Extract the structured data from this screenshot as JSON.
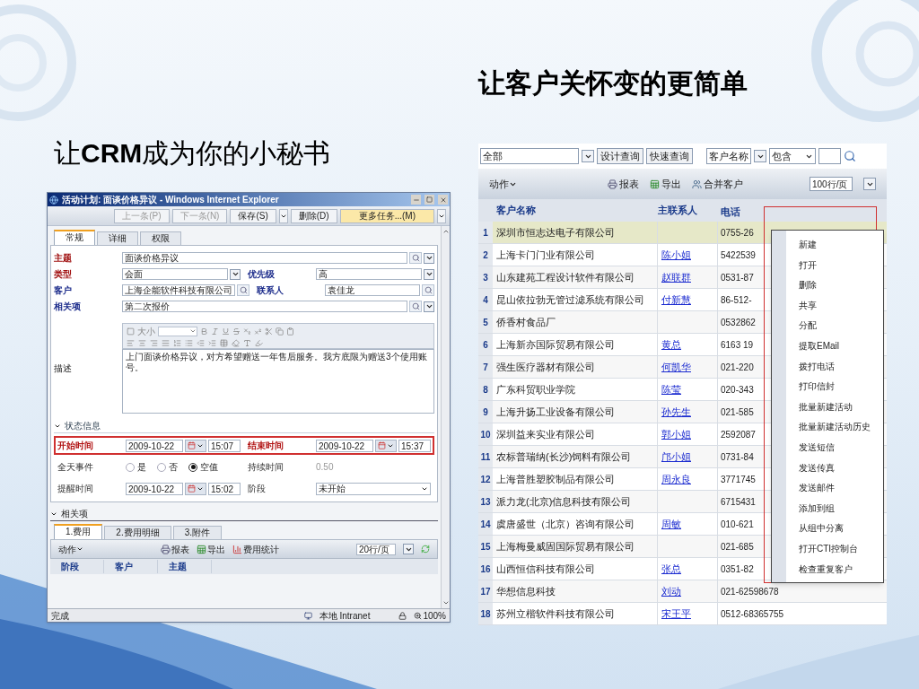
{
  "headline": "让客户关怀变的更简单",
  "subheadline": "让**CRM**成为你的小秘书",
  "activity_window": {
    "title": "活动计划: 面谈价格异议 - Windows Internet Explorer",
    "toolbar": [
      {
        "label": "上一条(P)",
        "disabled": true,
        "has_menu": false,
        "highlighted": false
      },
      {
        "label": "下一条(N)",
        "disabled": true,
        "has_menu": false,
        "highlighted": false
      },
      {
        "label": "保存(S)",
        "disabled": false,
        "has_menu": true,
        "highlighted": false
      },
      {
        "label": "删除(D)",
        "disabled": false,
        "has_menu": false,
        "highlighted": false
      },
      {
        "label": "更多任务...(M)",
        "disabled": false,
        "has_menu": true,
        "highlighted": true
      }
    ],
    "tabs": [
      {
        "label": "常规",
        "selected": true
      },
      {
        "label": "详细",
        "selected": false
      },
      {
        "label": "权限",
        "selected": false
      }
    ],
    "form_rows": [
      [
        {
          "label": "主题",
          "value": "面谈价格异议",
          "required": true,
          "kind": "lookupmenu"
        }
      ],
      [
        {
          "label": "类型",
          "value": "会面",
          "required": true,
          "kind": "select"
        },
        {
          "label": "优先级",
          "value": "高",
          "required": false,
          "kind": "select"
        }
      ],
      [
        {
          "label": "客户",
          "value": "上海企能软件科技有限公司",
          "required": false,
          "kind": "lookup"
        },
        {
          "label": "联系人",
          "value": "袁佳龙",
          "required": false,
          "kind": "lookup"
        }
      ],
      [
        {
          "label": "相关项",
          "value": "第二次报价",
          "required": false,
          "kind": "lookupmenu"
        }
      ]
    ],
    "editor": {
      "size_label": "大小"
    },
    "description": {
      "label": "描述",
      "value": "上门面谈价格异议，对方希望赠送一年售后服务。我方底限为赠送3个使用账号。"
    },
    "status_section": {
      "title": "状态信息",
      "expanded": true,
      "rows": [
        {
          "highlighted": true,
          "cells": [
            {
              "kind": "datetime",
              "label": "开始时间",
              "required": true,
              "date": "2009-10-22",
              "time": "15:07"
            },
            {
              "kind": "datetime",
              "label": "结束时间",
              "required": true,
              "date": "2009-10-22",
              "time": "15:37"
            }
          ]
        },
        {
          "highlighted": false,
          "cells": [
            {
              "kind": "radio",
              "label": "全天事件",
              "required": false,
              "options": [
                {
                  "label": "是",
                  "selected": false
                },
                {
                  "label": "否",
                  "selected": false
                },
                {
                  "label": "空值",
                  "selected": true
                }
              ]
            },
            {
              "kind": "readonly",
              "label": "持续时间",
              "required": false,
              "value": "0.50"
            }
          ]
        },
        {
          "highlighted": false,
          "cells": [
            {
              "kind": "datetime",
              "label": "提醒时间",
              "required": false,
              "date": "2009-10-22",
              "time": "15:02"
            },
            {
              "kind": "select",
              "label": "阶段",
              "required": false,
              "value": "未开始"
            }
          ]
        }
      ]
    },
    "related_section": {
      "title": "相关项",
      "expanded": true,
      "tabs": [
        {
          "label": "1.费用",
          "selected": true
        },
        {
          "label": "2.费用明细",
          "selected": false
        },
        {
          "label": "3.附件",
          "selected": false
        }
      ],
      "action": "动作",
      "tools": [
        {
          "kind": "report",
          "label": "报表"
        },
        {
          "kind": "export",
          "label": "导出"
        },
        {
          "kind": "chart",
          "label": "费用统计"
        }
      ],
      "page_size": "20行/页",
      "columns": [
        "阶段",
        "客户",
        "主题"
      ]
    },
    "status_bar": {
      "text": "完成",
      "zone": "本地 Intranet",
      "zoom": "100%"
    }
  },
  "customer_list": {
    "filter": {
      "view": "全部",
      "buttons": [
        "设计查询",
        "快速查询"
      ],
      "field": "客户名称",
      "operator": "包含"
    },
    "action": "动作",
    "tools": [
      {
        "kind": "report",
        "label": "报表"
      },
      {
        "kind": "export",
        "label": "导出"
      },
      {
        "kind": "merge",
        "label": "合并客户"
      }
    ],
    "page_size": "100行/页",
    "columns": [
      "客户名称",
      "主联系人",
      "电话"
    ],
    "rows": [
      {
        "num": "1",
        "name": "深圳市恒志达电子有限公司",
        "phone": "0755-26",
        "selected": true
      },
      {
        "num": "2",
        "name": "上海卡门门业有限公司",
        "contact": "陈小姐",
        "phone": "5422539",
        "selected": false
      },
      {
        "num": "3",
        "name": "山东建苑工程设计软件有限公司",
        "contact": "赵联群",
        "phone": "0531-87",
        "selected": false
      },
      {
        "num": "4",
        "name": "昆山依拉勃无管过滤系统有限公司",
        "contact": "付新慧",
        "phone": "86-512-",
        "selected": false
      },
      {
        "num": "5",
        "name": "侨香村食品厂",
        "phone": "0532862",
        "selected": false
      },
      {
        "num": "6",
        "name": "上海新亦国际贸易有限公司",
        "contact": "黄总",
        "phone": "6163 19",
        "selected": false
      },
      {
        "num": "7",
        "name": "强生医疗器材有限公司",
        "contact": "何凯华",
        "phone": "021-220",
        "selected": false
      },
      {
        "num": "8",
        "name": "广东科贸职业学院",
        "contact": "陈莹",
        "phone": "020-343",
        "selected": false
      },
      {
        "num": "9",
        "name": "上海升扬工业设备有限公司",
        "contact": "孙先生",
        "phone": "021-585",
        "selected": false
      },
      {
        "num": "10",
        "name": "深圳益来实业有限公司",
        "contact": "郭小姐",
        "phone": "2592087",
        "selected": false
      },
      {
        "num": "11",
        "name": "农标普瑞纳(长沙)饲料有限公司",
        "contact": "邝小姐",
        "phone": "0731-84",
        "selected": false
      },
      {
        "num": "12",
        "name": "上海普胜塑胶制品有限公司",
        "contact": "周永良",
        "phone": "3771745",
        "selected": false
      },
      {
        "num": "13",
        "name": "派力龙(北京)信息科技有限公司",
        "phone": "6715431",
        "selected": false
      },
      {
        "num": "14",
        "name": "虞唐盛世（北京）咨询有限公司",
        "contact": "周敏",
        "phone": "010-621",
        "selected": false
      },
      {
        "num": "15",
        "name": "上海梅曼威固国际贸易有限公司",
        "phone": "021-685",
        "selected": false
      },
      {
        "num": "16",
        "name": "山西恒信科技有限公司",
        "contact": "张总",
        "phone": "0351-82",
        "selected": false
      },
      {
        "num": "17",
        "name": "华想信息科技",
        "contact": "刘动",
        "phone": "021-62598678",
        "selected": false
      },
      {
        "num": "18",
        "name": "苏州立楷软件科技有限公司",
        "contact": "宋王平",
        "phone": "0512-68365755",
        "selected": false
      }
    ],
    "context_menu": [
      "新建",
      "打开",
      "删除",
      "共享",
      "分配",
      "提取EMail",
      "拨打电话",
      "打印信封",
      "批量新建活动",
      "批量新建活动历史",
      "发送短信",
      "发送传真",
      "发送邮件",
      "添加到组",
      "从组中分离",
      "打开CTI控制台",
      "检查重复客户"
    ]
  }
}
